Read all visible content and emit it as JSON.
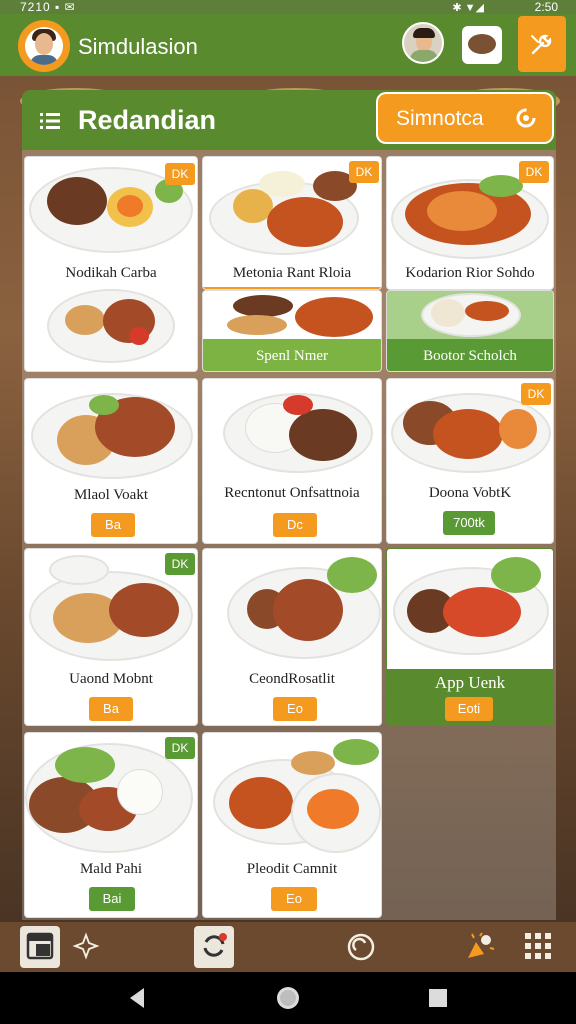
{
  "status_bar": {
    "left": "7210 ▪ ✉",
    "right": "2:50",
    "icons": "✱ ▼◢"
  },
  "app_bar": {
    "title": "Simdulasion"
  },
  "panel": {
    "title": "Redandian",
    "action_label": "Simnotca"
  },
  "cards": [
    {
      "label": "Nodikah Carba",
      "badge": "DK",
      "badge_color": "orange"
    },
    {
      "label": "Metonia Rant Rloia",
      "badge": "DK",
      "badge_color": "orange"
    },
    {
      "label": "Kodarion Rior Sohdo",
      "badge": "DK",
      "badge_color": "orange"
    },
    {
      "label": "Mlaol Voakt",
      "pill": "Ba",
      "pill_color": "orange"
    },
    {
      "label": "Recntonut Onfsattnoia",
      "pill": "Dc",
      "pill_color": "orange"
    },
    {
      "label": "Doona VobtK",
      "badge": "DK",
      "badge_color": "orange",
      "pill": "700tk",
      "pill_color": "green"
    },
    {
      "label": "Uaond Mobnt",
      "badge": "DK",
      "badge_color": "green",
      "pill": "Ba",
      "pill_color": "orange"
    },
    {
      "label": "CeondRosatlit",
      "pill": "Eo",
      "pill_color": "orange"
    },
    {
      "label": "App Uenk",
      "pill": "Eoti",
      "pill_color": "orange"
    },
    {
      "label": "Mald Pahi",
      "badge": "DK",
      "badge_color": "green",
      "pill": "Bai",
      "pill_color": "green"
    },
    {
      "label": "Pleodit Camnit",
      "pill": "Eo",
      "pill_color": "orange"
    }
  ],
  "green_bands": {
    "spent": "Spenl Nmer",
    "bootor": "Bootor Scholch"
  },
  "colors": {
    "primary_green": "#5a8a2e",
    "accent_orange": "#f39a1f",
    "band_green": "#7cb342"
  },
  "icons": {
    "menu": "hamburger-icon",
    "panel_action": "gear-refresh-icon",
    "tool": "wrench-icon"
  }
}
